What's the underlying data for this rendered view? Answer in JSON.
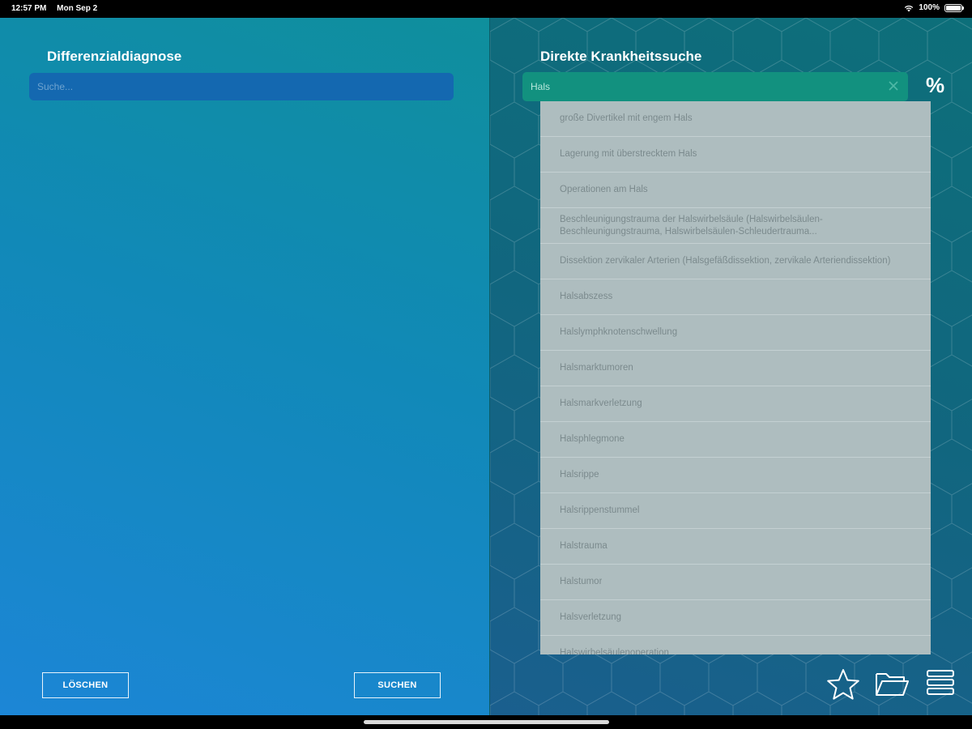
{
  "status_bar": {
    "time": "12:57 PM",
    "date": "Mon Sep 2",
    "battery": "100%"
  },
  "left_panel": {
    "title": "Differenzialdiagnose",
    "search_placeholder": "Suche...",
    "clear_label": "LÖSCHEN",
    "search_label": "SUCHEN"
  },
  "right_panel": {
    "title": "Direkte Krankheitssuche",
    "search_value": "Hals",
    "percent_label": "%",
    "results": [
      "große Divertikel mit engem Hals",
      "Lagerung mit überstrecktem Hals",
      "Operationen am Hals",
      "Beschleunigungstrauma der Halswirbelsäule (Halswirbelsäulen-Beschleunigungstrauma, Halswirbelsäulen-Schleudertrauma...",
      "Dissektion zervikaler Arterien (Halsgefäßdissektion, zervikale Arteriendissektion)",
      "Halsabszess",
      "Halslymphknotenschwellung",
      "Halsmarktumoren",
      "Halsmarkverletzung",
      "Halsphlegmone",
      "Halsrippe",
      "Halsrippenstummel",
      "Halstrauma",
      "Halstumor",
      "Halsverletzung",
      "Halswirbelsäulenoperation"
    ]
  },
  "icons": {
    "star": "star-icon",
    "folder": "folder-icon",
    "menu": "menu-icon",
    "clear": "close-icon"
  },
  "colors": {
    "left_gradient_top": "#0f8f9c",
    "left_gradient_bottom": "#1c86d6",
    "right_background": "#0d6f7a",
    "right_search_bg": "#12917f",
    "dropdown_bg": "#aebdbf"
  }
}
